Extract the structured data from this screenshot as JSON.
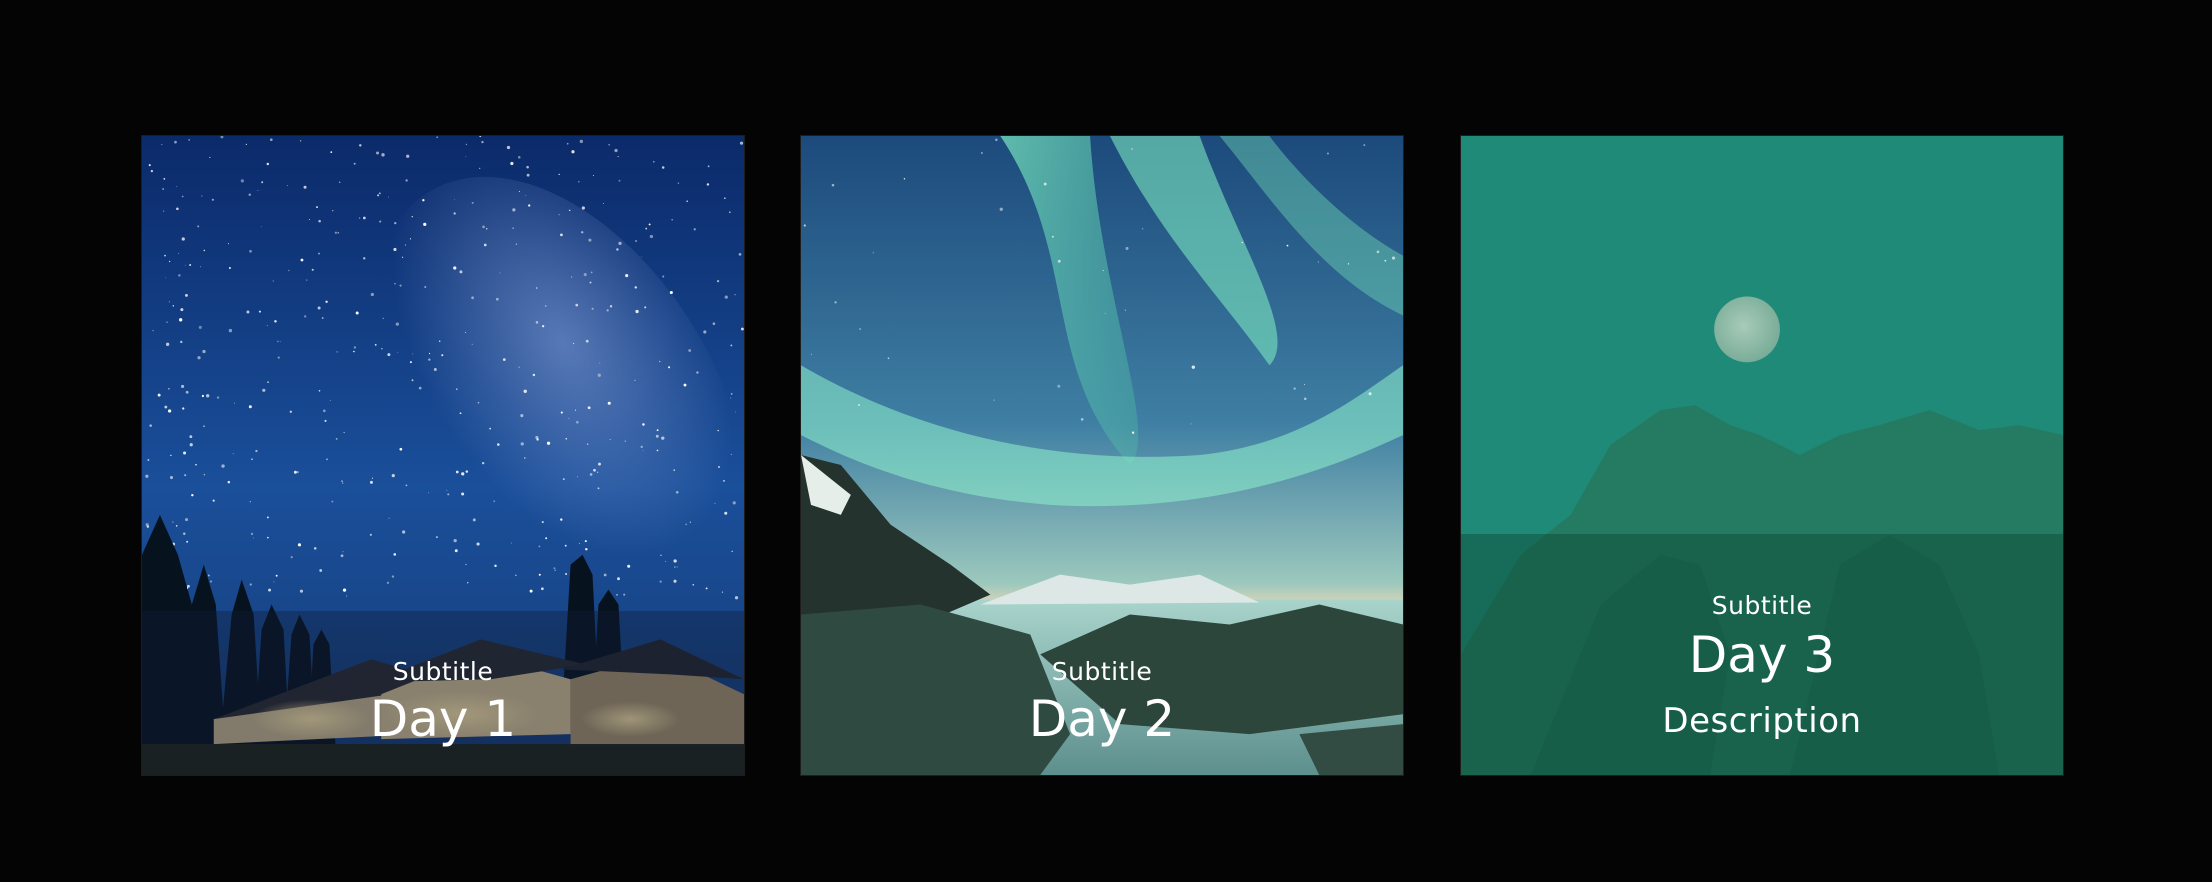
{
  "cards": [
    {
      "subtitle": "Subtitle",
      "title": "Day 1",
      "image": "starry-sky-cabins"
    },
    {
      "subtitle": "Subtitle",
      "title": "Day 2",
      "image": "aurora-rocky-coast"
    },
    {
      "subtitle": "Subtitle",
      "title": "Day 3",
      "description": "Description",
      "image": "moon-mountain-teal"
    }
  ],
  "colors": {
    "background": "#040404",
    "card3_tint": "#1f8a77",
    "text": "#ffffff"
  }
}
